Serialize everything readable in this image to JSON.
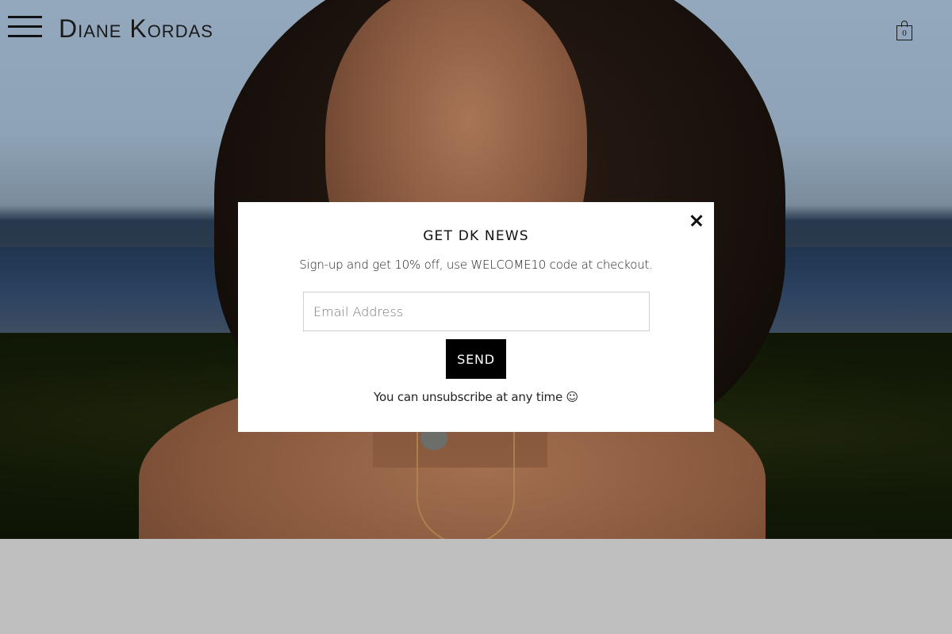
{
  "header": {
    "brand": "Diane Kordas",
    "cart_count": "0",
    "menu_icon": "hamburger-menu-icon",
    "cart_icon": "shopping-bag-icon"
  },
  "popup": {
    "title": "GET DK NEWS",
    "subtitle": "Sign-up and get 10% off, use WELCOME10 code at checkout.",
    "email_placeholder": "Email Address",
    "email_value": "",
    "send_label": "SEND",
    "footer_note": "You can unsubscribe at any time ☺",
    "close_icon": "close-icon"
  },
  "colors": {
    "background_band": "#bfbfbf",
    "popup_bg": "#ffffff",
    "button_bg": "#000000",
    "button_text": "#ffffff"
  }
}
